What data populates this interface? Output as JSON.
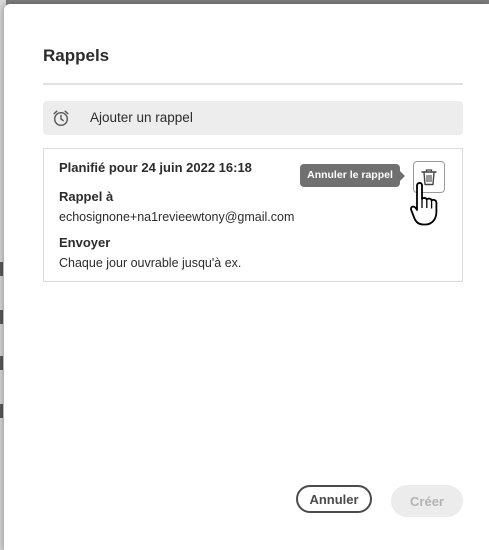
{
  "dialog": {
    "title": "Rappels"
  },
  "add_reminder": {
    "icon": "alarm-clock-icon",
    "label": "Ajouter un rappel"
  },
  "reminder": {
    "scheduled": "Planifié pour 24 juin 2022 16:18",
    "to_heading": "Rappel à",
    "to_value": "echosignone+na1revieewtony@gmail.com",
    "send_heading": "Envoyer",
    "send_value": "Chaque jour ouvrable jusqu'à ex.",
    "delete_icon": "trash-icon",
    "tooltip": "Annuler le rappel"
  },
  "footer": {
    "cancel_label": "Annuler",
    "create_label": "Créer"
  },
  "colors": {
    "accent_text": "#2c2c2c",
    "tooltip_bg": "#707070",
    "disabled_bg": "#ececec",
    "overlay": "#7c7c7c"
  }
}
